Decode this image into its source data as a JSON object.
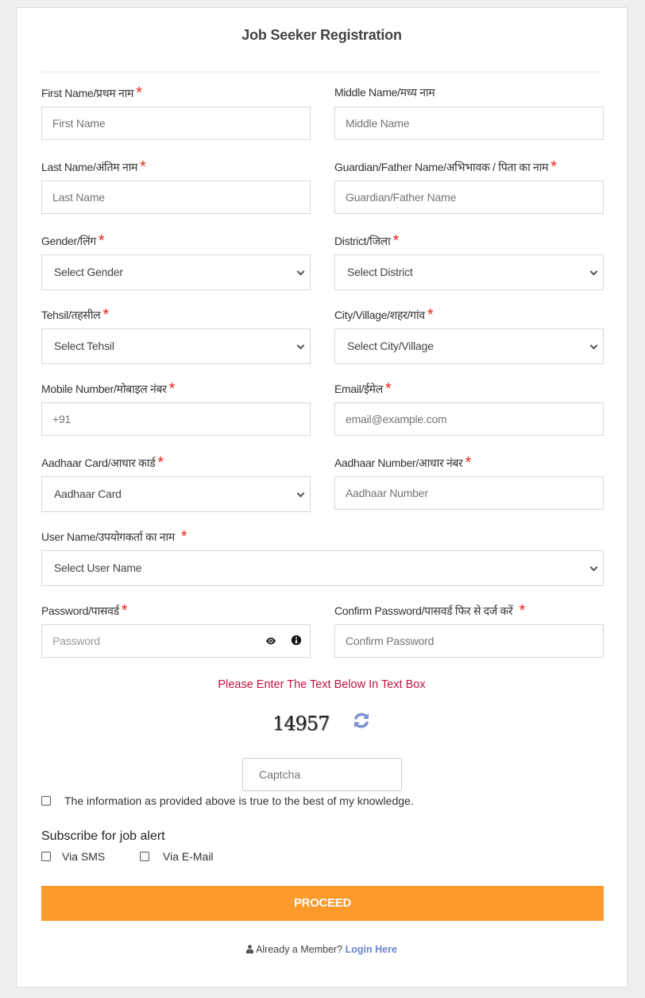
{
  "page": {
    "title": "Job Seeker Registration"
  },
  "fields": {
    "first_name": {
      "label": "First Name/प्रथम नाम",
      "placeholder": "First Name",
      "required": true
    },
    "middle_name": {
      "label": "Middle Name/मध्य नाम",
      "placeholder": "Middle Name",
      "required": false
    },
    "last_name": {
      "label": "Last Name/अंतिम नाम",
      "placeholder": "Last Name",
      "required": true
    },
    "guardian_name": {
      "label": "Guardian/Father Name/अभिभावक / पिता का नाम",
      "placeholder": "Guardian/Father Name",
      "required": true
    },
    "gender": {
      "label": "Gender/लिंग",
      "selected": "Select Gender",
      "required": true
    },
    "district": {
      "label": "District/जिला",
      "selected": "Select District",
      "required": true
    },
    "tehsil": {
      "label": "Tehsil/तहसील",
      "selected": "Select Tehsil",
      "required": true
    },
    "city_village": {
      "label": "City/Village/शहर/गांव",
      "selected": "Select City/Village",
      "required": true
    },
    "mobile": {
      "label": "Mobile Number/मोबाइल नंबर",
      "placeholder": "+91",
      "required": true
    },
    "email": {
      "label": "Email/ईमेल",
      "placeholder": "email@example.com",
      "required": true
    },
    "id_type": {
      "label": "Aadhaar Card/आधार कार्ड",
      "selected": "Aadhaar Card",
      "required": true
    },
    "id_number": {
      "label": "Aadhaar Number/आधार नंबर",
      "placeholder": "Aadhaar Number",
      "required": true
    },
    "username": {
      "label": "User Name/उपयोगकर्ता का नाम",
      "selected": "Select User Name",
      "required": true
    },
    "password": {
      "label": "Password/पासवर्ड",
      "placeholder": "Password",
      "required": true
    },
    "confirm_password": {
      "label": "Confirm Password/पासवर्ड फिर से दर्ज करें",
      "placeholder": "Confirm Password",
      "required": true
    }
  },
  "required_marker": "*",
  "captcha": {
    "instruction": "Please Enter The Text Below In Text Box",
    "code": "14957",
    "placeholder": "Captcha"
  },
  "declaration": {
    "label": "The information as provided above is true to the best of my knowledge.",
    "checked": false
  },
  "subscribe": {
    "heading": "Subscribe for job alert",
    "options": [
      {
        "label": "Via SMS",
        "checked": false
      },
      {
        "label": "Via E-Mail",
        "checked": false
      }
    ]
  },
  "actions": {
    "proceed_label": "PROCEED",
    "member_text": "Already a Member?",
    "login_link": "Login Here"
  },
  "colors": {
    "accent": "#fc9a2b",
    "required": "#e8271c",
    "captcha_note": "#c0143c",
    "link": "#6b85cc"
  }
}
